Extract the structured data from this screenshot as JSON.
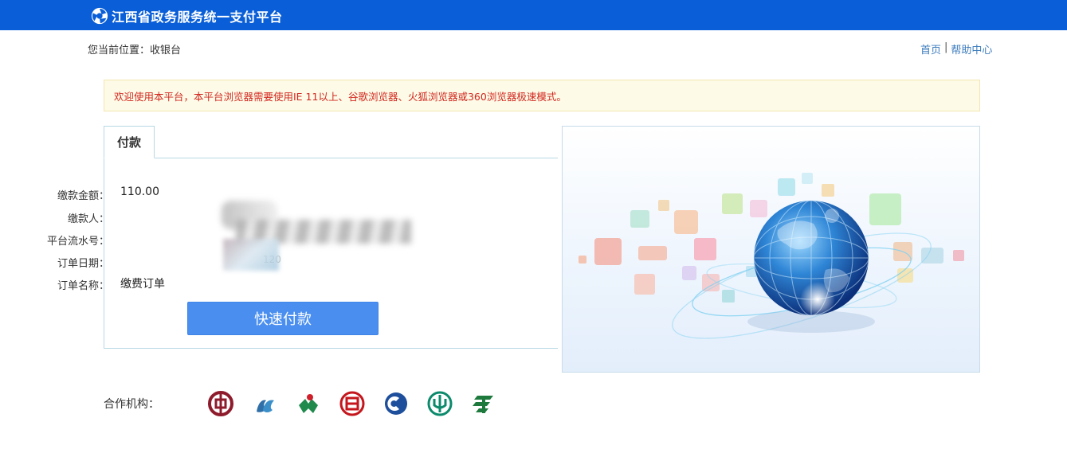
{
  "header": {
    "title": "江西省政务服务统一支付平台",
    "color": "#0a5fd8"
  },
  "breadcrumb": {
    "text": "您当前位置：收银台"
  },
  "toplinks": {
    "home": "首页",
    "separator": "|",
    "help": "帮助中心"
  },
  "notice": {
    "text": "欢迎使用本平台，本平台浏览器需要使用IE 11以上、谷歌浏览器、火狐浏览器或360浏览器极速模式。",
    "color": "#d2261f"
  },
  "payment": {
    "tab_label": "付款",
    "fields": [
      {
        "label": "缴款金额：",
        "value": "110.00"
      },
      {
        "label": "缴款人：",
        "value": ""
      },
      {
        "label": "平台流水号：",
        "value": ""
      },
      {
        "label": "订单日期：",
        "value": "120"
      },
      {
        "label": "订单名称：",
        "value": "缴费订单"
      }
    ],
    "button_label": "快速付款",
    "button_color": "#4a8ff0"
  },
  "partners": {
    "label": "合作机构：",
    "logos": [
      {
        "icon": "bank-of-china-icon",
        "color": "#8e1b2c"
      },
      {
        "icon": "rural-bank-icon",
        "color": "#2f6fa8"
      },
      {
        "icon": "agricultural-bank-icon",
        "color": "#1f8a4c"
      },
      {
        "icon": "icbc-icon",
        "color": "#c4161c"
      },
      {
        "icon": "ccb-icon",
        "color": "#1e4f9c"
      },
      {
        "icon": "rural-credit-icon",
        "color": "#0c8a6c"
      },
      {
        "icon": "postal-bank-icon",
        "color": "#1e7a3c"
      }
    ]
  }
}
